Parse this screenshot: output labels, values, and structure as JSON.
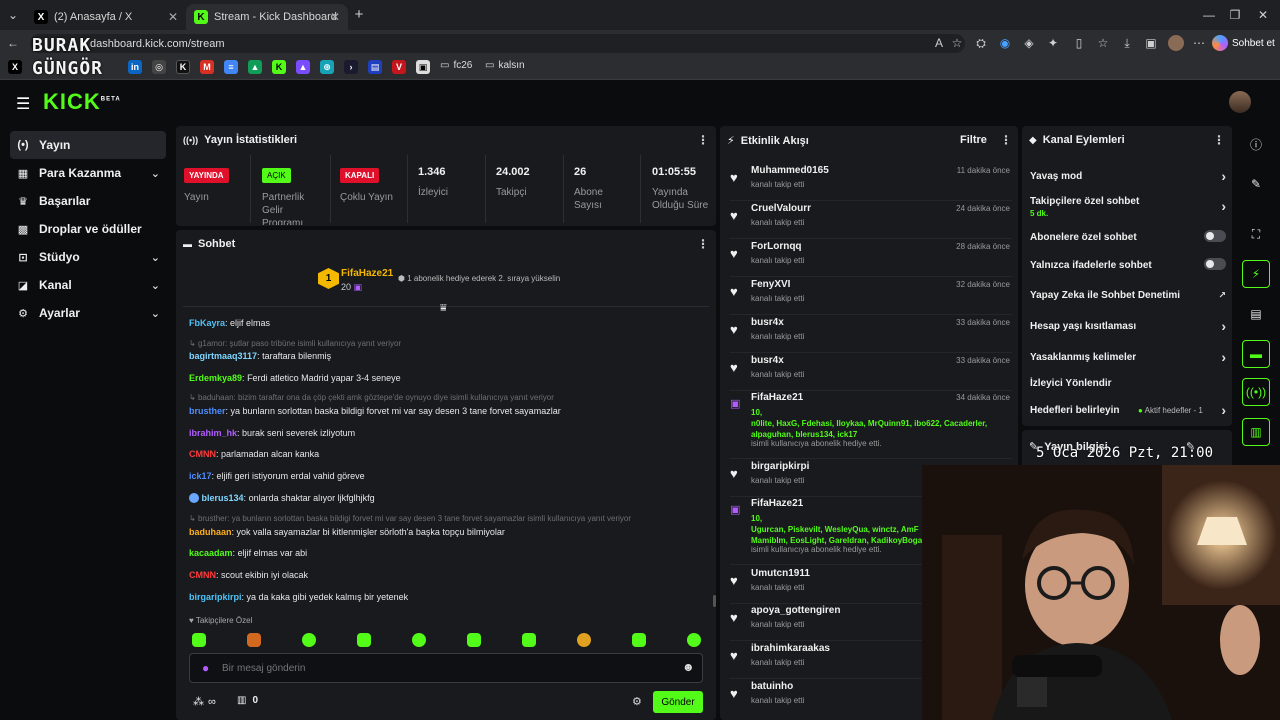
{
  "browser": {
    "tabs": [
      {
        "title": "(2) Anasayfa / X",
        "favicon": "X"
      },
      {
        "title": "Stream - Kick Dashboard",
        "favicon": "K"
      }
    ],
    "url": "dashboard.kick.com/stream",
    "copilot_label": "Sohbet et",
    "bookmarks": [
      "fc26",
      "kalsın"
    ],
    "watermark": [
      "BURAK",
      "GÜNGÖR"
    ]
  },
  "kick": {
    "logo": "KICK",
    "logo_sup": "BETA"
  },
  "sidebar": {
    "items": [
      {
        "label": "Yayın",
        "icon": "broadcast-icon"
      },
      {
        "label": "Para Kazanma",
        "icon": "money-icon"
      },
      {
        "label": "Başarılar",
        "icon": "trophy-icon"
      },
      {
        "label": "Droplar ve ödüller",
        "icon": "gift-icon"
      },
      {
        "label": "Stüdyo",
        "icon": "studio-icon"
      },
      {
        "label": "Kanal",
        "icon": "channel-icon"
      },
      {
        "label": "Ayarlar",
        "icon": "gear-icon"
      }
    ]
  },
  "stats": {
    "title": "Yayın İstatistikleri",
    "live_badge": "YAYINDA",
    "live_label": "Yayın",
    "partner_badge": "AÇIK",
    "partner_label1": "Partnerlik",
    "partner_label2": "Gelir",
    "partner_label3": "Programı",
    "multi_badge": "KAPALI",
    "multi_label": "Çoklu Yayın",
    "viewers": "1.346",
    "viewers_label": "İzleyici",
    "followers": "24.002",
    "followers_label": "Takipçi",
    "subs": "26",
    "subs_label1": "Abone",
    "subs_label2": "Sayısı",
    "uptime": "01:05:55",
    "uptime_label1": "Yayında",
    "uptime_label2": "Olduğu Süre"
  },
  "chat": {
    "title": "Sohbet",
    "pinned_rank": "1",
    "pinned_user": "FifaHaze21",
    "pinned_count": "20",
    "pinned_text": "1 abonelik hediye ederek 2. sıraya yükselin",
    "messages": [
      {
        "user": "FbKayra",
        "color": "#4fc3f7",
        "text": "eljif elmas"
      },
      {
        "reply": "g1amor: şutlar paso tribüne isimli kullanıcıya yanıt veriyor",
        "user": "bagirtmaaq3117",
        "color": "#7fd7ff",
        "text": "taraftara bilenmiş"
      },
      {
        "user": "Erdemkya89",
        "color": "#53fc18",
        "text": "Ferdi atletico Madrid yapar 3-4 seneye"
      },
      {
        "reply": "baduhaan: bizim taraftar ona da çöp çekti amk göztepe'de oynuyo diye isimli kullanıcıya yanıt veriyor",
        "user": "brusther",
        "color": "#4f8dff",
        "text": "ya bunların sorlottan baska bildigi forvet mi var say desen 3 tane forvet sayamazlar"
      },
      {
        "user": "ibrahim_hk",
        "color": "#b25cff",
        "text": "burak seni severek izliyotum"
      },
      {
        "user": "CMNN",
        "color": "#ff3b3b",
        "text": "parlamadan alcan kanka"
      },
      {
        "user": "ick17",
        "color": "#4f8dff",
        "text": "eljifi geri istiyorum erdal vahid göreve"
      },
      {
        "user": "blerus134",
        "color": "#7fd7ff",
        "text": "onlarda shaktar alıyor ljkfglhjkfg"
      },
      {
        "reply": "brusther: ya bunların sorlottan baska bildigi forvet mi var say desen 3 tane forvet sayamazlar isimli kullanıcıya yanıt veriyor",
        "user": "baduhaan",
        "color": "#ffb020",
        "text": "yok valla sayamazlar bi kitlenmişler sörloth'a başka topçu bilmiyolar"
      },
      {
        "user": "kacaadam",
        "color": "#53fc18",
        "text": "eljif elmas var abi"
      },
      {
        "user": "CMNN",
        "color": "#ff3b3b",
        "text": "scout ekibin iyi olacak"
      },
      {
        "user": "birgaripkirpi",
        "color": "#4fc3f7",
        "text": "ya da kaka gibi yedek kalmış bir yetenek"
      }
    ],
    "emote_section": "Takipçilere Özel",
    "input_placeholder": "Bir mesaj gönderin",
    "points": "∞",
    "gift_count": "0",
    "send_label": "Gönder"
  },
  "activity": {
    "title": "Etkinlik Akışı",
    "filter_label": "Filtre",
    "events": [
      {
        "name": "Muhammed0165",
        "sub": "kanalı takip etti",
        "time": "11 dakika önce",
        "type": "follow"
      },
      {
        "name": "CruelValourr",
        "sub": "kanalı takip etti",
        "time": "24 dakika önce",
        "type": "follow"
      },
      {
        "name": "ForLornqq",
        "sub": "kanalı takip etti",
        "time": "28 dakika önce",
        "type": "follow"
      },
      {
        "name": "FenyXVI",
        "sub": "kanalı takip etti",
        "time": "32 dakika önce",
        "type": "follow"
      },
      {
        "name": "busr4x",
        "sub": "kanalı takip etti",
        "time": "33 dakika önce",
        "type": "follow"
      },
      {
        "name": "busr4x",
        "sub": "kanalı takip etti",
        "time": "33 dakika önce",
        "type": "follow"
      },
      {
        "name": "FifaHaze21",
        "count": "10,",
        "list1": "n0lite, HaxG, Fdehasi, Iloykaa, MrQuinn91, ibo622, Cacaderler,",
        "list2": "alpaguhan, blerus134, ick17",
        "sub": "isimli kullanıcıya abonelik hediye etti.",
        "time": "34 dakika önce",
        "type": "gift"
      },
      {
        "name": "birgaripkirpi",
        "sub": "kanalı takip etti",
        "time": "36 dakika önce",
        "type": "follow"
      },
      {
        "name": "FifaHaze21",
        "count": "10,",
        "list1": "Ugurcan, Piskevilt, WesleyQua, winctz, AmF",
        "list2": "Mamiblm, EosLight, Gareldran, KadikoyBoga",
        "sub": "isimli kullanıcıya abonelik hediye etti.",
        "time": "",
        "type": "gift"
      },
      {
        "name": "Umutcn1911",
        "sub": "kanalı takip etti",
        "time": "",
        "type": "follow"
      },
      {
        "name": "apoya_gottengiren",
        "sub": "kanalı takip etti",
        "time": "",
        "type": "follow"
      },
      {
        "name": "ibrahimkaraakas",
        "sub": "kanalı takip etti",
        "time": "",
        "type": "follow"
      },
      {
        "name": "batuinho",
        "sub": "kanalı takip etti",
        "time": "",
        "type": "follow"
      }
    ]
  },
  "channel_actions": {
    "title": "Kanal Eylemleri",
    "slow_mode": "Yavaş mod",
    "followers_only": "Takipçilere özel sohbet",
    "followers_only_value": "5 dk.",
    "subs_only": "Abonelere özel sohbet",
    "emotes_only": "Yalnızca ifadelerle sohbet",
    "ai_moderation": "Yapay Zeka ile Sohbet Denetimi",
    "age_restriction": "Hesap yaşı kısıtlaması",
    "banned_words": "Yasaklanmış kelimeler",
    "raid": "İzleyici Yönlendir",
    "goals": "Hedefleri belirleyin",
    "goals_status": "Aktif hedefler - 1",
    "stream_info": "Yayın bilgisi"
  },
  "overlay": {
    "timestamp": "5 Oca 2026 Pzt, 21:00"
  },
  "colors": {
    "accent": "#53fc18",
    "live_red": "#e0102a"
  }
}
